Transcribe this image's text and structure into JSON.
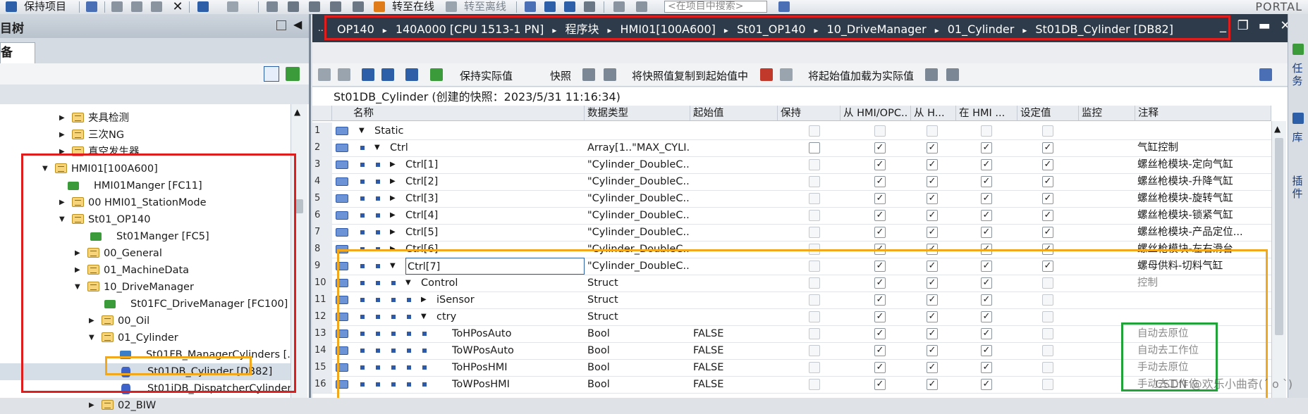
{
  "toolbar": {
    "save_project": "保持项目",
    "go_online": "转至在线",
    "go_offline": "转至离线",
    "search_placeholder": "<在项目中搜索>",
    "brand": "PORTAL"
  },
  "left_panel": {
    "title": "目树",
    "tab": "备",
    "tree": [
      {
        "label": "夹具检测",
        "expanded": false
      },
      {
        "label": "三次NG",
        "expanded": false
      },
      {
        "label": "真空发生器",
        "expanded": false
      },
      {
        "label": "HMI01[100A600]",
        "expanded": true
      },
      {
        "label": "HMI01Manger [FC11]",
        "type": "fc"
      },
      {
        "label": "00 HMI01_StationMode",
        "expanded": false
      },
      {
        "label": "St01_OP140",
        "expanded": true
      },
      {
        "label": "St01Manger [FC5]",
        "type": "fc"
      },
      {
        "label": "00_General",
        "expanded": false
      },
      {
        "label": "01_MachineData",
        "expanded": false
      },
      {
        "label": "10_DriveManager",
        "expanded": true
      },
      {
        "label": "St01FC_DriveManager [FC100]",
        "type": "fc"
      },
      {
        "label": "00_Oil",
        "expanded": false
      },
      {
        "label": "01_Cylinder",
        "expanded": true
      },
      {
        "label": "St01FB_ManagerCylinders [...",
        "type": "fb"
      },
      {
        "label": "St01DB_Cylinder [DB82]",
        "type": "db",
        "selected": true
      },
      {
        "label": "St01iDB_DispatcherCylinder...",
        "type": "db"
      },
      {
        "label": "02_BIW",
        "expanded": false
      }
    ]
  },
  "editor": {
    "breadcrumb": [
      "OP140",
      "140A000 [CPU 1513-1 PN]",
      "程序块",
      "HMI01[100A600]",
      "St01_OP140",
      "10_DriveManager",
      "01_Cylinder",
      "St01DB_Cylinder [DB82]"
    ],
    "breadcrumb_sep": "▸",
    "toolbar": {
      "keep_actual": "保持实际值",
      "snapshot": "快照",
      "copy_snapshot": "将快照值复制到起始值中",
      "load_start": "将起始值加载为实际值"
    },
    "snapshot_title": "St01DB_Cylinder (创建的快照：2023/5/31 11:16:34)",
    "columns": [
      "名称",
      "数据类型",
      "起始值",
      "保持",
      "从 HMI/OPC..",
      "从 H...",
      "在 HMI ...",
      "设定值",
      "监控",
      "注释"
    ],
    "rows": [
      {
        "num": "1",
        "level": 0,
        "arrow": "down",
        "name": "Static",
        "type": "",
        "start": "",
        "keep": "dis",
        "hmi": "dis",
        "fromh": "dis",
        "inhmi": "dis",
        "setval": "dis",
        "comment": ""
      },
      {
        "num": "2",
        "level": 1,
        "arrow": "down",
        "name": "Ctrl",
        "type": "Array[1..\"MAX_CYLI...",
        "start": "",
        "keep": "off",
        "hmi": "on",
        "fromh": "on",
        "inhmi": "on",
        "setval": "on",
        "comment": "气缸控制"
      },
      {
        "num": "3",
        "level": 2,
        "arrow": "right",
        "name": "Ctrl[1]",
        "type": "\"Cylinder_DoubleC...",
        "start": "",
        "keep": "dis",
        "hmi": "on",
        "fromh": "on",
        "inhmi": "on",
        "setval": "on",
        "comment": "螺丝枪模块-定向气缸"
      },
      {
        "num": "4",
        "level": 2,
        "arrow": "right",
        "name": "Ctrl[2]",
        "type": "\"Cylinder_DoubleC...",
        "start": "",
        "keep": "dis",
        "hmi": "on",
        "fromh": "on",
        "inhmi": "on",
        "setval": "on",
        "comment": "螺丝枪模块-升降气缸"
      },
      {
        "num": "5",
        "level": 2,
        "arrow": "right",
        "name": "Ctrl[3]",
        "type": "\"Cylinder_DoubleC...",
        "start": "",
        "keep": "dis",
        "hmi": "on",
        "fromh": "on",
        "inhmi": "on",
        "setval": "on",
        "comment": "螺丝枪模块-旋转气缸"
      },
      {
        "num": "6",
        "level": 2,
        "arrow": "right",
        "name": "Ctrl[4]",
        "type": "\"Cylinder_DoubleC...",
        "start": "",
        "keep": "dis",
        "hmi": "on",
        "fromh": "on",
        "inhmi": "on",
        "setval": "on",
        "comment": "螺丝枪模块-锁紧气缸"
      },
      {
        "num": "7",
        "level": 2,
        "arrow": "right",
        "name": "Ctrl[5]",
        "type": "\"Cylinder_DoubleC...",
        "start": "",
        "keep": "dis",
        "hmi": "on",
        "fromh": "on",
        "inhmi": "on",
        "setval": "on",
        "comment": "螺丝枪模块-产品定位..."
      },
      {
        "num": "8",
        "level": 2,
        "arrow": "right",
        "name": "Ctrl[6]",
        "type": "\"Cylinder_DoubleC...",
        "start": "",
        "keep": "dis",
        "hmi": "on",
        "fromh": "on",
        "inhmi": "on",
        "setval": "on",
        "comment": "螺丝枪模块-左右滑台"
      },
      {
        "num": "9",
        "level": 2,
        "arrow": "down",
        "name": "Ctrl[7]",
        "type": "\"Cylinder_DoubleC...",
        "start": "",
        "keep": "dis",
        "hmi": "on",
        "fromh": "on",
        "inhmi": "on",
        "setval": "on",
        "comment": "螺母供料-切料气缸",
        "selected": true
      },
      {
        "num": "10",
        "level": 3,
        "arrow": "down",
        "name": "Control",
        "type": "Struct",
        "start": "",
        "keep": "dis",
        "hmi": "on",
        "fromh": "on",
        "inhmi": "on",
        "setval": "dis",
        "comment": "控制",
        "cgray": true
      },
      {
        "num": "11",
        "level": 4,
        "arrow": "right",
        "name": "iSensor",
        "type": "Struct",
        "start": "",
        "keep": "dis",
        "hmi": "on",
        "fromh": "on",
        "inhmi": "on",
        "setval": "dis",
        "comment": ""
      },
      {
        "num": "12",
        "level": 4,
        "arrow": "down",
        "name": "ctry",
        "type": "Struct",
        "start": "",
        "keep": "dis",
        "hmi": "on",
        "fromh": "on",
        "inhmi": "on",
        "setval": "dis",
        "comment": ""
      },
      {
        "num": "13",
        "level": 5,
        "arrow": "",
        "name": "ToHPosAuto",
        "type": "Bool",
        "start": "FALSE",
        "keep": "dis",
        "hmi": "on",
        "fromh": "on",
        "inhmi": "on",
        "setval": "dis",
        "comment": "自动去原位",
        "cgray": true
      },
      {
        "num": "14",
        "level": 5,
        "arrow": "",
        "name": "ToWPosAuto",
        "type": "Bool",
        "start": "FALSE",
        "keep": "dis",
        "hmi": "on",
        "fromh": "on",
        "inhmi": "on",
        "setval": "dis",
        "comment": "自动去工作位",
        "cgray": true
      },
      {
        "num": "15",
        "level": 5,
        "arrow": "",
        "name": "ToHPosHMI",
        "type": "Bool",
        "start": "FALSE",
        "keep": "dis",
        "hmi": "on",
        "fromh": "on",
        "inhmi": "on",
        "setval": "dis",
        "comment": "手动去原位",
        "cgray": true
      },
      {
        "num": "16",
        "level": 5,
        "arrow": "",
        "name": "ToWPosHMI",
        "type": "Bool",
        "start": "FALSE",
        "keep": "dis",
        "hmi": "on",
        "fromh": "on",
        "inhmi": "on",
        "setval": "dis",
        "comment": "手动去工作位",
        "cgray": true
      }
    ],
    "side_tabs": [
      "任务",
      "库",
      "插件"
    ]
  },
  "watermark": "CSDN @欢乐小曲奇(ˊ o ˋ)"
}
